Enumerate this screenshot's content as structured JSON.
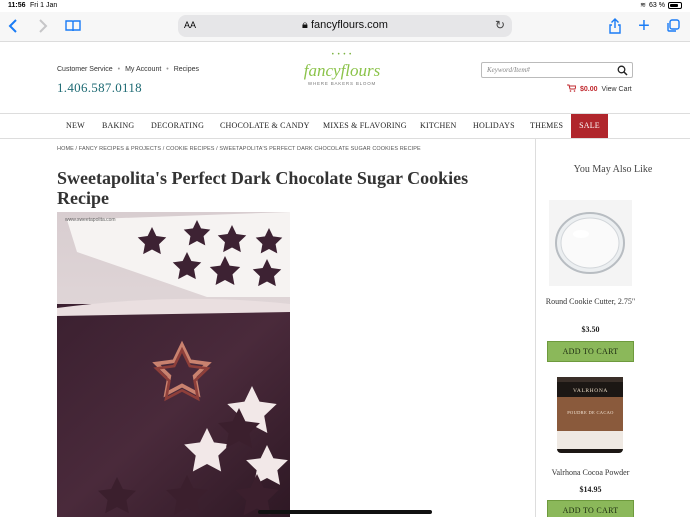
{
  "status_bar": {
    "time": "11:56",
    "date": "Fri 1 Jan",
    "battery": "63 %"
  },
  "browser": {
    "reader_label": "AA",
    "url": "fancyflours.com"
  },
  "header": {
    "links": [
      "Customer Service",
      "My Account",
      "Recipes"
    ],
    "phone": "1.406.587.0118",
    "logo_text": "fancyflours",
    "logo_tagline": "WHERE BAKERS BLOOM",
    "search_placeholder": "Keyword/Item#",
    "cart_amount": "$0.00",
    "view_cart": "View Cart"
  },
  "nav": [
    "NEW",
    "BAKING",
    "DECORATING",
    "CHOCOLATE & CANDY",
    "MIXES & FLAVORING",
    "KITCHEN",
    "HOLIDAYS",
    "THEMES",
    "SALE"
  ],
  "breadcrumb": "HOME / FANCY RECIPES & PROJECTS / COOKIE RECIPES / SWEETAPOLITA'S PERFECT DARK CHOCOLATE SUGAR COOKIES RECIPE",
  "page_title": "Sweetapolita's Perfect Dark Chocolate Sugar Cookies Recipe",
  "image_watermark": "www.sweetapolita.com",
  "sidebar": {
    "heading": "You May Also Like",
    "products": [
      {
        "name": "Round Cookie Cutter, 2.75\"",
        "price": "$3.50",
        "button": "ADD TO CART"
      },
      {
        "name": "Valrhona Cocoa Powder",
        "price": "$14.95",
        "button": "ADD TO CART"
      }
    ],
    "cocoa_brand": "VALRHONA",
    "cocoa_label": "POUDRE DE CACAO"
  },
  "colors": {
    "sale_bg": "#b0262c",
    "add_to_cart": "#8bb85a",
    "phone": "#1f6b74",
    "logo_green": "#8bc34a"
  }
}
